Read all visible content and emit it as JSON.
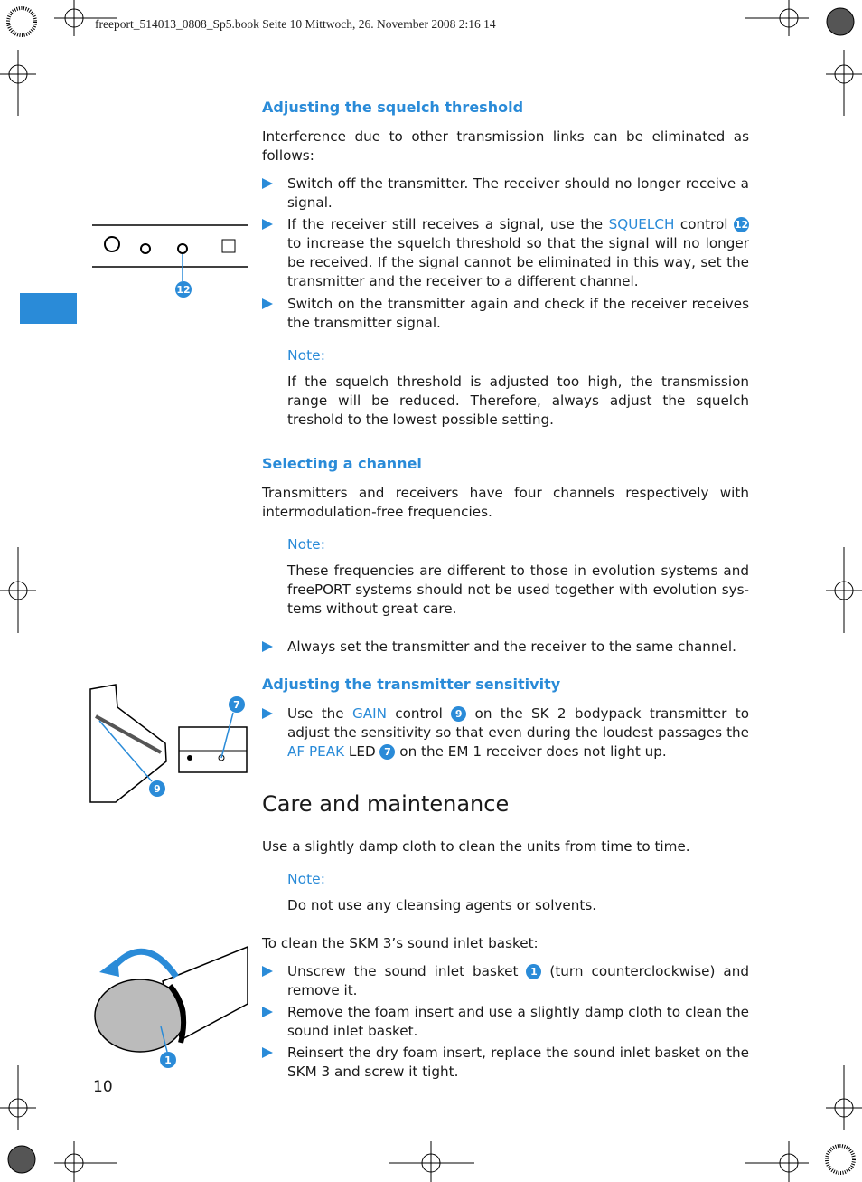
{
  "header": {
    "slug": "freeport_514013_0808_Sp5.book  Seite 10  Mittwoch, 26. November 2008  2:16 14"
  },
  "colors": {
    "accent": "#2a8bd8",
    "text": "#1a1a1a"
  },
  "sections": {
    "squelch": {
      "heading": "Adjusting the squelch threshold",
      "intro": "Interference due to other transmission links can be eliminated as follows:",
      "bullets": [
        [
          {
            "t": "Switch off the transmitter. The receiver should no longer receive a signal."
          }
        ],
        [
          {
            "t": "If the receiver still receives a signal, use the "
          },
          {
            "hl": "SQUELCH"
          },
          {
            "t": " control "
          },
          {
            "num": "12"
          },
          {
            "t": " to increase the squelch threshold so that the signal will no longer be received. If the signal cannot be eliminated in this way, set the transmitter and the receiver to a different channel."
          }
        ],
        [
          {
            "t": "Switch on the transmitter again and check if the receiver receives the transmitter signal."
          }
        ]
      ],
      "note_label": "Note:",
      "note": "If the squelch threshold is adjusted too high, the transmission range will be reduced. Therefore, always adjust the squelch treshold to the lowest possible setting.",
      "figure_callout": "12"
    },
    "channel": {
      "heading": "Selecting a channel",
      "intro": "Transmitters and receivers have four channels respectively with intermodulation-free frequencies.",
      "note_label": "Note:",
      "note": "These frequencies are different to those in evolution systems and freePORT systems should not be used together with evolution sys-tems without great care.",
      "bullets": [
        [
          {
            "t": "Always set the transmitter and the receiver to the same channel."
          }
        ]
      ]
    },
    "sensitivity": {
      "heading": "Adjusting the transmitter sensitivity",
      "bullets": [
        [
          {
            "t": "Use the "
          },
          {
            "hl": "GAIN"
          },
          {
            "t": " control "
          },
          {
            "num": "9"
          },
          {
            "t": " on the SK 2 bodypack transmitter to adjust the sensitivity so that even during the loudest passages the "
          },
          {
            "hl": "AF PEAK"
          },
          {
            "t": " LED "
          },
          {
            "num": "7"
          },
          {
            "t": " on the EM 1 receiver does not light up."
          }
        ]
      ],
      "figure_callouts": [
        "7",
        "9"
      ]
    },
    "care": {
      "heading": "Care and maintenance",
      "intro": "Use a slightly damp cloth to clean the units from time to time.",
      "note_label": "Note:",
      "note": "Do not use any cleansing agents or solvents.",
      "lead": "To clean the SKM 3’s sound inlet basket:",
      "bullets": [
        [
          {
            "t": "Unscrew the sound inlet basket "
          },
          {
            "num": "1"
          },
          {
            "t": " (turn counterclockwise) and remove it."
          }
        ],
        [
          {
            "t": "Remove the foam insert and use a slightly damp cloth to clean the sound inlet basket."
          }
        ],
        [
          {
            "t": "Reinsert the dry foam insert, replace the sound inlet basket on the SKM 3 and screw it tight."
          }
        ]
      ],
      "figure_callout": "1"
    }
  },
  "page_number": "10"
}
